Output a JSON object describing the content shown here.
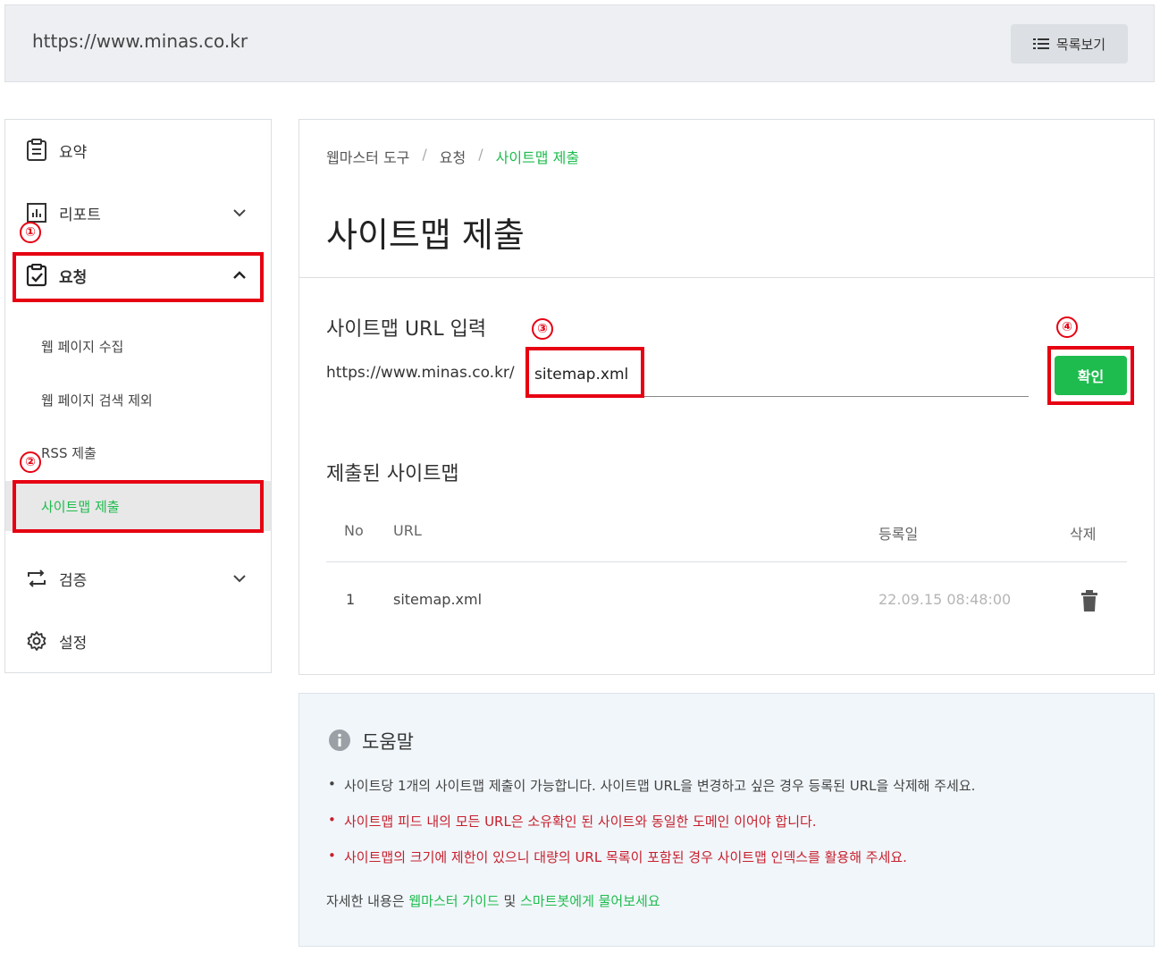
{
  "topbar": {
    "site_url": "https://www.minas.co.kr",
    "list_button": "목록보기"
  },
  "sidebar": {
    "items": [
      {
        "label": "요약",
        "icon": "clipboard-icon"
      },
      {
        "label": "리포트",
        "icon": "bar-chart-icon"
      },
      {
        "label": "요청",
        "icon": "clipboard-check-icon"
      },
      {
        "label": "검증",
        "icon": "repeat-icon"
      },
      {
        "label": "설정",
        "icon": "gear-icon"
      }
    ],
    "request_sub": [
      "웹 페이지 수집",
      "웹 페이지 검색 제외",
      "RSS 제출",
      "사이트맵 제출"
    ]
  },
  "main": {
    "breadcrumb": [
      "웹마스터 도구",
      "요청",
      "사이트맵 제출"
    ],
    "title": "사이트맵 제출",
    "input_section_title": "사이트맵 URL 입력",
    "url_prefix": "https://www.minas.co.kr/",
    "input_value": "sitemap.xml",
    "confirm_button": "확인",
    "submitted_title": "제출된 사이트맵",
    "table": {
      "headers": [
        "No",
        "URL",
        "등록일",
        "삭제"
      ],
      "rows": [
        {
          "no": "1",
          "url": "sitemap.xml",
          "date": "22.09.15 08:48:00"
        }
      ]
    }
  },
  "help": {
    "title": "도움말",
    "items": [
      "사이트당 1개의 사이트맵 제출이 가능합니다. 사이트맵 URL을 변경하고 싶은 경우 등록된 URL을 삭제해 주세요.",
      "사이트맵 피드 내의 모든 URL은 소유확인 된 사이트와 동일한 도메인 이어야 합니다.",
      "사이트맵의 크기에 제한이 있으니 대량의 URL 목록이 포함된 경우 사이트맵 인덱스를 활용해 주세요."
    ],
    "footer_prefix": "자세한 내용은 ",
    "guide_link": "웹마스터 가이드",
    "footer_mid": " 및 ",
    "bot_link": "스마트봇에게 물어보세요"
  },
  "markers": [
    "①",
    "②",
    "③",
    "④"
  ],
  "colors": {
    "accent": "#1ebc4e",
    "annotation": "#e60012",
    "warning_text": "#c7202e"
  }
}
